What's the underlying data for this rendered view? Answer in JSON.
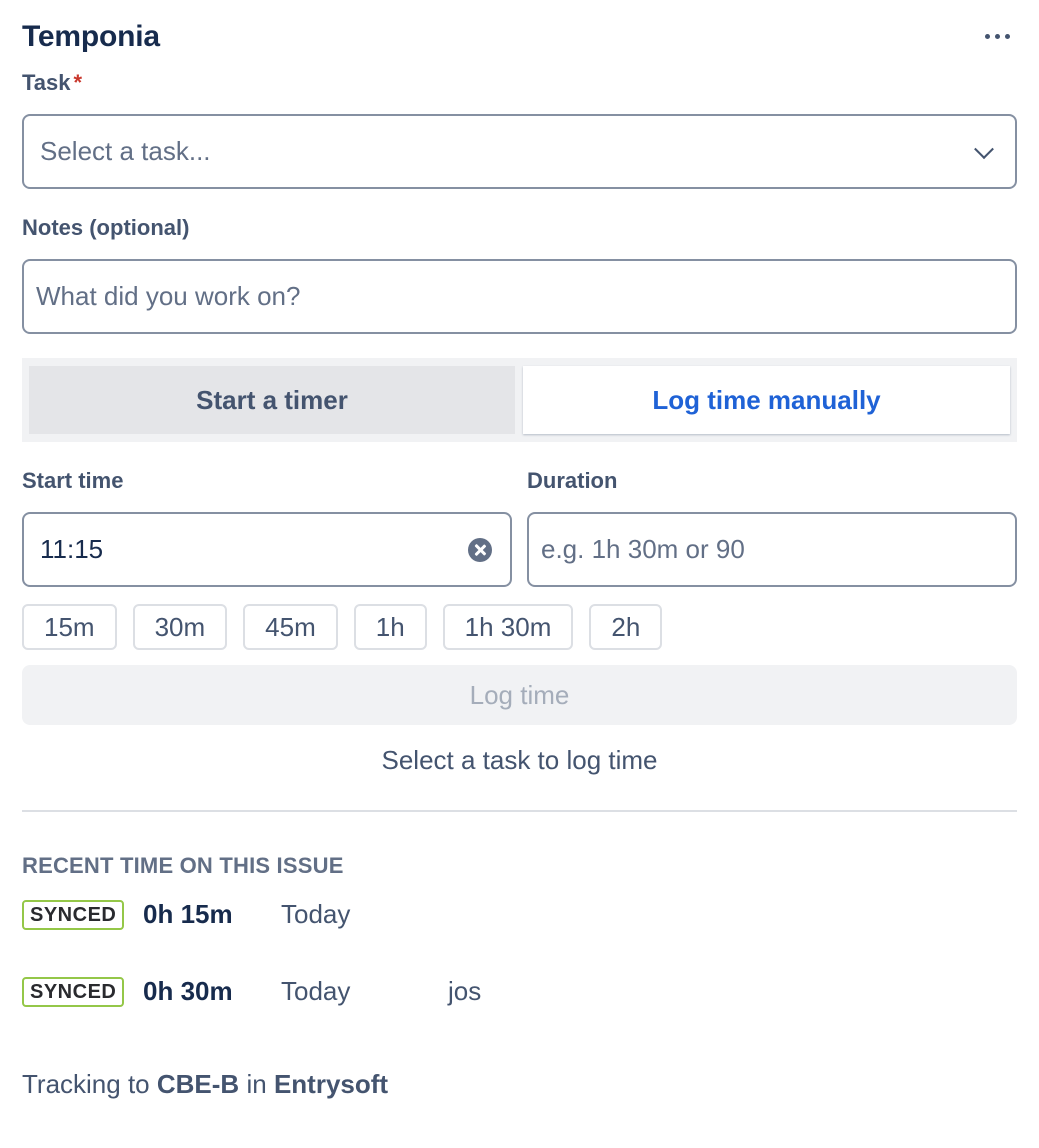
{
  "app": {
    "title": "Temponia"
  },
  "task": {
    "label": "Task",
    "required_mark": "*",
    "placeholder": "Select a task..."
  },
  "notes": {
    "label": "Notes (optional)",
    "placeholder": "What did you work on?"
  },
  "mode_toggle": {
    "timer_label": "Start a timer",
    "manual_label": "Log time manually",
    "active": "manual"
  },
  "start_time": {
    "label": "Start time",
    "value": "11:15"
  },
  "duration": {
    "label": "Duration",
    "placeholder": "e.g. 1h 30m or 90"
  },
  "quick_durations": [
    "15m",
    "30m",
    "45m",
    "1h",
    "1h 30m",
    "2h"
  ],
  "log_button": {
    "label": "Log time",
    "enabled": false
  },
  "hint": "Select a task to log time",
  "recent": {
    "title": "RECENT TIME ON THIS ISSUE",
    "entries": [
      {
        "status": "SYNCED",
        "duration": "0h 15m",
        "when": "Today",
        "user": ""
      },
      {
        "status": "SYNCED",
        "duration": "0h 30m",
        "when": "Today",
        "user": "jos"
      }
    ]
  },
  "footer": {
    "prefix": "Tracking to",
    "issue_key": "CBE-B",
    "connector": "in",
    "project": "Entrysoft"
  },
  "colors": {
    "accent": "#1f62d6",
    "synced_border": "#94c748",
    "required": "#c9372c"
  }
}
